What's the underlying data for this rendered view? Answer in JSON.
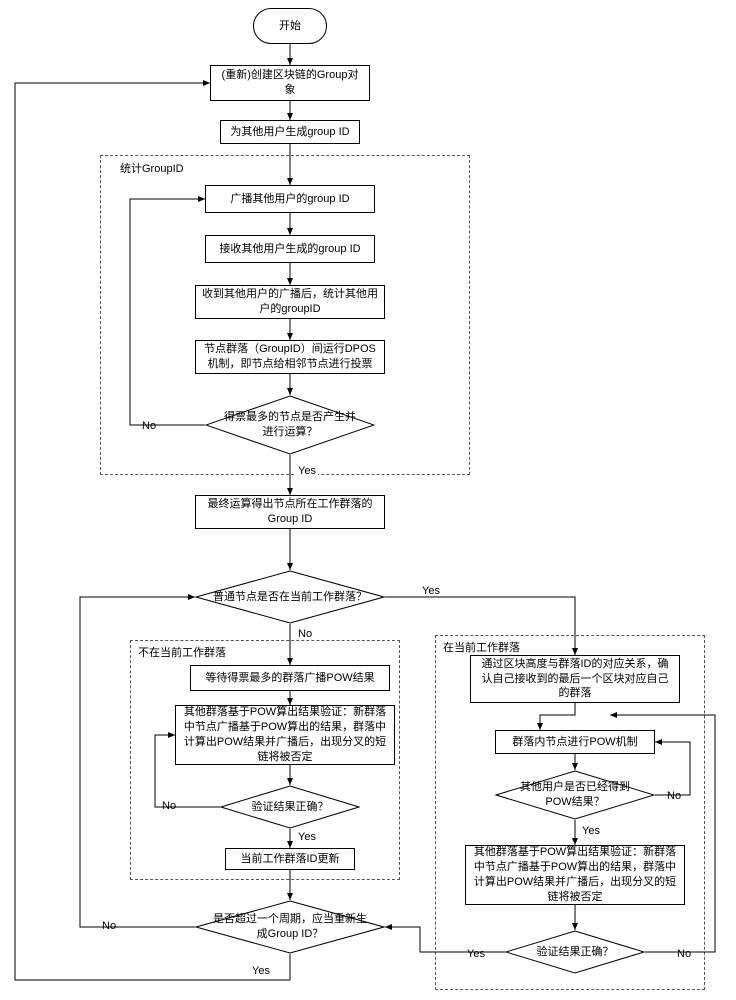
{
  "nodes": {
    "start": "开始",
    "recreate_group_obj": "(重新)创建区块链的Group对象",
    "gen_group_id": "为其他用户生成group ID",
    "broadcast_other": "广播其他用户的group ID",
    "receive_other": "接收其他用户生成的group ID",
    "after_receive": "收到其他用户的广播后，统计其他用户的groupID",
    "dpos": "节点群落（GroupID）间运行DPOS机制，即节点给相邻节点进行投票",
    "most_votes_d": "得票最多的节点是否产生并进行运算？",
    "calc_out": "最终运算得出节点所在工作群落的Group ID",
    "in_current_d": "普通节点是否在当前工作群落？",
    "wait_pow": "等待得票最多的群落广播POW结果",
    "verify_left": "其他群落基于POW算出结果验证：新群落中节点广播基于POW算出的结果，群落中计算出POW结果并广播后，出现分叉的短链将被否定",
    "verify_correct_left": "验证结果正确？",
    "update_group_id": "当前工作群落ID更新",
    "over_period_d": "是否超过一个周期，应当重新生成Group ID？",
    "confirm_block": "通过区块高度与群落ID的对应关系，确认自己接收到的最后一个区块对应自己的群落",
    "pow_in_group": "群落内节点进行POW机制",
    "others_got_pow": "其他用户是否已经得到POW结果？",
    "verify_right": "其他群落基于POW算出结果验证：新群落中节点广播基于POW算出的结果，群落中计算出POW结果并广播后，出现分叉的短链将被否定",
    "verify_correct_right": "验证结果正确？"
  },
  "groups": {
    "stat_group_id": "统计GroupID",
    "not_in_current": "不在当前工作群落",
    "in_current": "在当前工作群落"
  },
  "labels": {
    "yes": "Yes",
    "no": "No",
    "no_cn": "No"
  },
  "chart_data": {
    "type": "flowchart",
    "start": "start",
    "nodes": [
      {
        "id": "start",
        "type": "terminator"
      },
      {
        "id": "recreate_group_obj",
        "type": "process"
      },
      {
        "id": "gen_group_id",
        "type": "process"
      },
      {
        "id": "broadcast_other",
        "type": "process",
        "group": "stat_group_id"
      },
      {
        "id": "receive_other",
        "type": "process",
        "group": "stat_group_id"
      },
      {
        "id": "after_receive",
        "type": "process",
        "group": "stat_group_id"
      },
      {
        "id": "dpos",
        "type": "process",
        "group": "stat_group_id"
      },
      {
        "id": "most_votes_d",
        "type": "decision",
        "group": "stat_group_id"
      },
      {
        "id": "calc_out",
        "type": "process"
      },
      {
        "id": "in_current_d",
        "type": "decision"
      },
      {
        "id": "wait_pow",
        "type": "process",
        "group": "not_in_current"
      },
      {
        "id": "verify_left",
        "type": "process",
        "group": "not_in_current"
      },
      {
        "id": "verify_correct_left",
        "type": "decision",
        "group": "not_in_current"
      },
      {
        "id": "update_group_id",
        "type": "process",
        "group": "not_in_current"
      },
      {
        "id": "over_period_d",
        "type": "decision"
      },
      {
        "id": "confirm_block",
        "type": "process",
        "group": "in_current"
      },
      {
        "id": "pow_in_group",
        "type": "process",
        "group": "in_current"
      },
      {
        "id": "others_got_pow",
        "type": "decision",
        "group": "in_current"
      },
      {
        "id": "verify_right",
        "type": "process",
        "group": "in_current"
      },
      {
        "id": "verify_correct_right",
        "type": "decision",
        "group": "in_current"
      }
    ],
    "edges": [
      {
        "from": "start",
        "to": "recreate_group_obj"
      },
      {
        "from": "recreate_group_obj",
        "to": "gen_group_id"
      },
      {
        "from": "gen_group_id",
        "to": "broadcast_other"
      },
      {
        "from": "broadcast_other",
        "to": "receive_other"
      },
      {
        "from": "receive_other",
        "to": "after_receive"
      },
      {
        "from": "after_receive",
        "to": "dpos"
      },
      {
        "from": "dpos",
        "to": "most_votes_d"
      },
      {
        "from": "most_votes_d",
        "to": "calc_out",
        "label": "Yes"
      },
      {
        "from": "most_votes_d",
        "to": "broadcast_other",
        "label": "No"
      },
      {
        "from": "calc_out",
        "to": "in_current_d"
      },
      {
        "from": "in_current_d",
        "to": "wait_pow",
        "label": "No"
      },
      {
        "from": "in_current_d",
        "to": "confirm_block",
        "label": "Yes"
      },
      {
        "from": "wait_pow",
        "to": "verify_left"
      },
      {
        "from": "verify_left",
        "to": "verify_correct_left"
      },
      {
        "from": "verify_correct_left",
        "to": "update_group_id",
        "label": "Yes"
      },
      {
        "from": "verify_correct_left",
        "to": "verify_left",
        "label": "No"
      },
      {
        "from": "update_group_id",
        "to": "over_period_d"
      },
      {
        "from": "over_period_d",
        "to": "recreate_group_obj",
        "label": "Yes"
      },
      {
        "from": "over_period_d",
        "to": "in_current_d",
        "label": "No"
      },
      {
        "from": "confirm_block",
        "to": "pow_in_group"
      },
      {
        "from": "pow_in_group",
        "to": "others_got_pow"
      },
      {
        "from": "others_got_pow",
        "to": "verify_right",
        "label": "Yes"
      },
      {
        "from": "others_got_pow",
        "to": "pow_in_group",
        "label": "No"
      },
      {
        "from": "verify_right",
        "to": "verify_correct_right"
      },
      {
        "from": "verify_correct_right",
        "to": "over_period_d",
        "label": "Yes"
      },
      {
        "from": "verify_correct_right",
        "to": "pow_in_group",
        "label": "No"
      }
    ],
    "groups": [
      {
        "id": "stat_group_id"
      },
      {
        "id": "not_in_current"
      },
      {
        "id": "in_current"
      }
    ]
  }
}
